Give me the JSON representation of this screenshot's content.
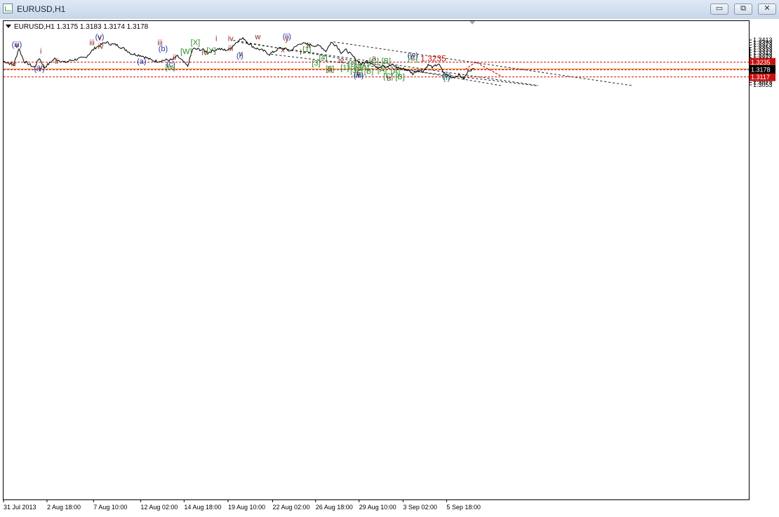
{
  "window": {
    "title": "EURUSD,H1",
    "buttons": {
      "minimize": "▭",
      "restore": "⧉",
      "close": "✕"
    }
  },
  "colors": {
    "brown": "#8b2a1b",
    "blue": "#2233aa",
    "green": "#2e8b2e",
    "red": "#cc1111",
    "orange": "#e07a1f",
    "black": "#000000",
    "grid": "#999999"
  },
  "chart_data": {
    "type": "line",
    "title": "EURUSD,H1  1.3175 1.3183 1.3174 1.3178",
    "header": {
      "symbol": "EURUSD,H1",
      "open": "1.3175",
      "high": "1.3183",
      "low": "1.3174",
      "close": "1.3178"
    },
    "xlabel": "",
    "ylabel": "",
    "grid": false,
    "ylim": [
      1.3043,
      1.3427
    ],
    "y_ticks": [
      "1.3413",
      "1.3393",
      "1.3373",
      "1.3353",
      "1.3333",
      "1.3313",
      "1.3293",
      "1.3273",
      "1.3253",
      "1.3233",
      "1.3213",
      "1.3193",
      "1.3173",
      "1.3153",
      "1.3133",
      "1.3113",
      "1.3093",
      "1.3073",
      "1.3053"
    ],
    "x_ticks": [
      {
        "label": "31 Jul 2013",
        "t": 0
      },
      {
        "label": "2 Aug 18:00",
        "t": 8.5
      },
      {
        "label": "7 Aug 10:00",
        "t": 17.6
      },
      {
        "label": "12 Aug 02:00",
        "t": 26.8
      },
      {
        "label": "14 Aug 18:00",
        "t": 35.3
      },
      {
        "label": "19 Aug 10:00",
        "t": 43.9
      },
      {
        "label": "22 Aug 02:00",
        "t": 52.6
      },
      {
        "label": "26 Aug 18:00",
        "t": 61.0
      },
      {
        "label": "29 Aug 10:00",
        "t": 69.5
      },
      {
        "label": "3 Sep 02:00",
        "t": 78.1
      },
      {
        "label": "5 Sep 18:00",
        "t": 86.6
      }
    ],
    "price_anchors": [
      [
        0,
        1.3243
      ],
      [
        2,
        1.3213
      ],
      [
        3,
        1.3347
      ],
      [
        4,
        1.3243
      ],
      [
        6,
        1.3193
      ],
      [
        7,
        1.3268
      ],
      [
        8,
        1.3193
      ],
      [
        10,
        1.3263
      ],
      [
        12,
        1.3233
      ],
      [
        13,
        1.3248
      ],
      [
        16,
        1.3273
      ],
      [
        18,
        1.3353
      ],
      [
        20,
        1.3395
      ],
      [
        21,
        1.338
      ],
      [
        22,
        1.3375
      ],
      [
        24,
        1.3333
      ],
      [
        25,
        1.3303
      ],
      [
        27,
        1.3288
      ],
      [
        29,
        1.325
      ],
      [
        30,
        1.3243
      ],
      [
        32,
        1.3253
      ],
      [
        33,
        1.3253
      ],
      [
        34,
        1.3283
      ],
      [
        35,
        1.3243
      ],
      [
        36,
        1.3203
      ],
      [
        37,
        1.3343
      ],
      [
        39,
        1.3333
      ],
      [
        40,
        1.3313
      ],
      [
        42,
        1.3343
      ],
      [
        43,
        1.3333
      ],
      [
        44,
        1.3333
      ],
      [
        46,
        1.3413
      ],
      [
        47,
        1.3425
      ],
      [
        48,
        1.3383
      ],
      [
        49,
        1.3353
      ],
      [
        51,
        1.3323
      ],
      [
        52,
        1.3298
      ],
      [
        53,
        1.3323
      ],
      [
        54,
        1.3348
      ],
      [
        55,
        1.3343
      ],
      [
        56,
        1.3323
      ],
      [
        58,
        1.3388
      ],
      [
        60,
        1.3373
      ],
      [
        62,
        1.3363
      ],
      [
        63,
        1.3323
      ],
      [
        64,
        1.3393
      ],
      [
        65,
        1.3373
      ],
      [
        66,
        1.3313
      ],
      [
        67,
        1.3333
      ],
      [
        68,
        1.3293
      ],
      [
        69,
        1.3253
      ],
      [
        70,
        1.3218
      ],
      [
        71,
        1.3243
      ],
      [
        72,
        1.3233
      ],
      [
        73,
        1.3183
      ],
      [
        74,
        1.3213
      ],
      [
        75,
        1.3198
      ],
      [
        76,
        1.3213
      ],
      [
        77,
        1.3193
      ],
      [
        78,
        1.3183
      ],
      [
        79,
        1.3173
      ],
      [
        80,
        1.3143
      ],
      [
        81,
        1.3173
      ],
      [
        82,
        1.3163
      ],
      [
        83,
        1.3213
      ],
      [
        84,
        1.3193
      ],
      [
        85,
        1.3223
      ],
      [
        86,
        1.3153
      ],
      [
        87,
        1.3123
      ],
      [
        88,
        1.3113
      ],
      [
        89,
        1.3133
      ],
      [
        90,
        1.3103
      ],
      [
        91,
        1.3173
      ],
      [
        92,
        1.3178
      ]
    ],
    "lines": [
      {
        "name": "1.3235",
        "value": 1.3235,
        "color": "red"
      },
      {
        "name": "1.3181",
        "value": 1.3181,
        "color": "orange"
      },
      {
        "name": "1.3174",
        "value": 1.3174,
        "color": "red"
      },
      {
        "name": "1.3117",
        "value": 1.3117,
        "color": "red"
      }
    ],
    "channel_lines": [
      [
        [
          46.5,
          1.3392
        ],
        [
          104.5,
          1.3048
        ]
      ],
      [
        [
          64.5,
          1.3398
        ],
        [
          123.1,
          1.3046
        ]
      ],
      [
        [
          52.3,
          1.3298
        ],
        [
          104.5,
          1.3045
        ]
      ],
      [
        [
          44.9,
          1.341
        ],
        [
          97.2,
          1.3048
        ]
      ]
    ],
    "projection": [
      [
        90.3,
        1.3178
      ],
      [
        92.3,
        1.3236
      ],
      [
        97.5,
        1.3118
      ]
    ],
    "annotations": [
      {
        "text": "(iii)",
        "t": 2.6,
        "p": 1.3357,
        "color": "blue"
      },
      {
        "text": "v",
        "t": 2.6,
        "p": 1.3349,
        "color": "brown"
      },
      {
        "text": "iv",
        "t": 2.0,
        "p": 1.3202,
        "color": "brown"
      },
      {
        "text": "y",
        "t": 7.2,
        "p": 1.3177,
        "color": "brown"
      },
      {
        "text": "(iv)",
        "t": 7.0,
        "p": 1.3163,
        "color": "blue"
      },
      {
        "text": "i",
        "t": 7.3,
        "p": 1.3304,
        "color": "brown"
      },
      {
        "text": "ii",
        "t": 10.4,
        "p": 1.3223,
        "color": "brown"
      },
      {
        "text": "iii",
        "t": 17.3,
        "p": 1.337,
        "color": "brown"
      },
      {
        "text": "(v)",
        "t": 18.8,
        "p": 1.3419,
        "color": "blue"
      },
      {
        "text": "v",
        "t": 18.8,
        "p": 1.3409,
        "color": "brown"
      },
      {
        "text": "iv",
        "t": 19.0,
        "p": 1.3343,
        "color": "brown"
      },
      {
        "text": "(a)",
        "t": 27.0,
        "p": 1.3223,
        "color": "blue"
      },
      {
        "text": "iii",
        "t": 30.6,
        "p": 1.337,
        "color": "brown"
      },
      {
        "text": "(b)",
        "t": 31.2,
        "p": 1.3322,
        "color": "blue"
      },
      {
        "text": "ii",
        "t": 33.4,
        "p": 1.3253,
        "color": "brown"
      },
      {
        "text": "(c)",
        "t": 32.7,
        "p": 1.3198,
        "color": "blue"
      },
      {
        "text": "[iv]",
        "t": 32.6,
        "p": 1.3177,
        "color": "green"
      },
      {
        "text": "[X]",
        "t": 37.5,
        "p": 1.3373,
        "color": "green"
      },
      {
        "text": "[W]",
        "t": 35.7,
        "p": 1.3301,
        "color": "green"
      },
      {
        "text": "[Y]",
        "t": 40.6,
        "p": 1.3309,
        "color": "green"
      },
      {
        "text": "iv",
        "t": 39.3,
        "p": 1.3293,
        "color": "brown"
      },
      {
        "text": "i",
        "t": 41.6,
        "p": 1.3405,
        "color": "brown"
      },
      {
        "text": "iv",
        "t": 44.4,
        "p": 1.3404,
        "color": "brown"
      },
      {
        "text": "iii",
        "t": 44.4,
        "p": 1.3325,
        "color": "brown"
      },
      {
        "text": "v",
        "t": 46.4,
        "p": 1.3285,
        "color": "brown"
      },
      {
        "text": "(i)",
        "t": 46.2,
        "p": 1.3267,
        "color": "blue"
      },
      {
        "text": "w",
        "t": 49.7,
        "p": 1.342,
        "color": "brown"
      },
      {
        "text": "(ii)",
        "t": 55.4,
        "p": 1.3421,
        "color": "blue"
      },
      {
        "text": "y",
        "t": 55.4,
        "p": 1.3405,
        "color": "brown"
      },
      {
        "text": "x",
        "t": 54.6,
        "p": 1.3315,
        "color": "brown"
      },
      {
        "text": "ii",
        "t": 59.6,
        "p": 1.3349,
        "color": "brown"
      },
      {
        "text": "[1]",
        "t": 59.3,
        "p": 1.3316,
        "color": "green"
      },
      {
        "text": "i",
        "t": 58.1,
        "p": 1.3295,
        "color": "brown"
      },
      {
        "text": "[4]",
        "t": 62.5,
        "p": 1.3252,
        "color": "green"
      },
      {
        "text": "[3]",
        "t": 61.1,
        "p": 1.3207,
        "color": "green"
      },
      {
        "text": "iv",
        "t": 66.0,
        "p": 1.3227,
        "color": "brown"
      },
      {
        "text": "[2]",
        "t": 68.2,
        "p": 1.3199,
        "color": "green"
      },
      {
        "text": "[4]",
        "t": 69.3,
        "p": 1.3183,
        "color": "green"
      },
      {
        "text": "[A]",
        "t": 70.5,
        "p": 1.3183,
        "color": "green"
      },
      {
        "text": "[1]",
        "t": 66.7,
        "p": 1.3171,
        "color": "green"
      },
      {
        "text": "[5]",
        "t": 63.8,
        "p": 1.3163,
        "color": "green"
      },
      {
        "text": "iii",
        "t": 63.8,
        "p": 1.3152,
        "color": "brown"
      },
      {
        "text": "[3]",
        "t": 68.6,
        "p": 1.3149,
        "color": "green"
      },
      {
        "text": "[B]",
        "t": 71.4,
        "p": 1.3143,
        "color": "green"
      },
      {
        "text": "[5]",
        "t": 69.4,
        "p": 1.3128,
        "color": "green"
      },
      {
        "text": "v",
        "t": 69.4,
        "p": 1.3118,
        "color": "brown"
      },
      {
        "text": "(iii)",
        "t": 69.4,
        "p": 1.3109,
        "color": "blue"
      },
      {
        "text": "a",
        "t": 72.4,
        "p": 1.3247,
        "color": "brown"
      },
      {
        "text": "[C]",
        "t": 72.4,
        "p": 1.3225,
        "color": "green"
      },
      {
        "text": "[B]",
        "t": 74.8,
        "p": 1.3226,
        "color": "green"
      },
      {
        "text": "[A]",
        "t": 74.0,
        "p": 1.3153,
        "color": "green"
      },
      {
        "text": "[A]",
        "t": 76.6,
        "p": 1.3141,
        "color": "green"
      },
      {
        "text": "[C]",
        "t": 75.2,
        "p": 1.3104,
        "color": "green"
      },
      {
        "text": "[B]",
        "t": 77.5,
        "p": 1.3097,
        "color": "green"
      },
      {
        "text": "b",
        "t": 75.3,
        "p": 1.3087,
        "color": "brown"
      },
      {
        "text": "(iv)",
        "t": 80.0,
        "p": 1.327,
        "color": "blue"
      },
      {
        "text": "c",
        "t": 80.0,
        "p": 1.3259,
        "color": "brown"
      },
      {
        "text": "[C]",
        "t": 80.0,
        "p": 1.3247,
        "color": "green"
      },
      {
        "text": "1.3235",
        "t": 84.0,
        "p": 1.3241,
        "color": "red"
      },
      {
        "text": "(v)",
        "t": 86.6,
        "p": 1.3106,
        "color": "blue"
      },
      {
        "text": "[i]",
        "t": 86.6,
        "p": 1.3093,
        "color": "green"
      }
    ]
  }
}
